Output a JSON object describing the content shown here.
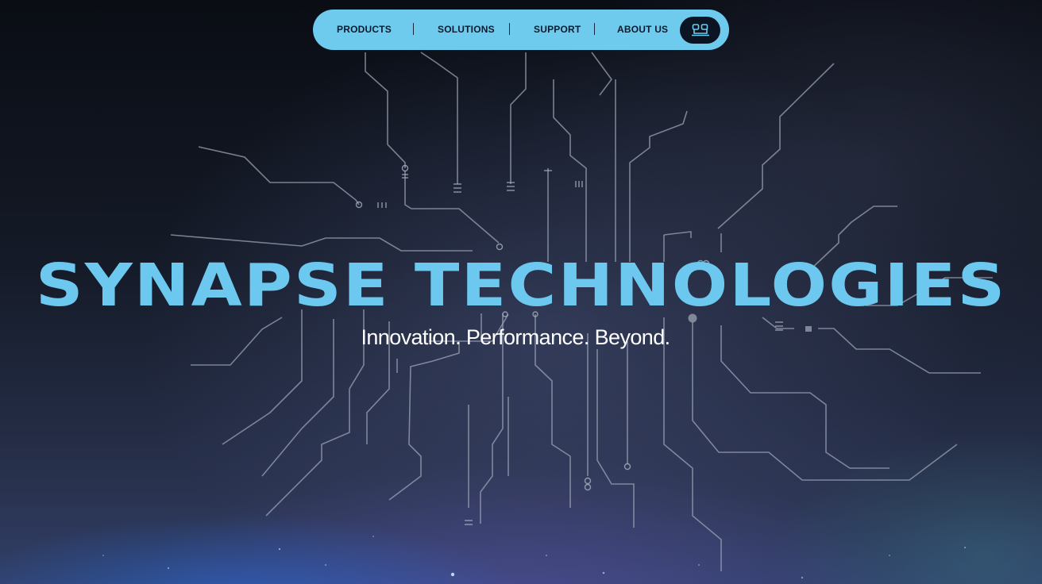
{
  "nav": {
    "items": [
      {
        "label": "PRODUCTS"
      },
      {
        "label": "SOLUTIONS"
      },
      {
        "label": "SUPPORT"
      },
      {
        "label": "ABOUT US"
      }
    ],
    "login_icon": "user-profile-icon"
  },
  "hero": {
    "title_first": "Synapse",
    "title_second": "Technologies",
    "tagline": "Innovation. Performance. Beyond."
  },
  "colors": {
    "nav_background": "#6ecbee",
    "nav_text": "#0d1a2b",
    "title": "#6cc8ee",
    "tagline": "#ffffff",
    "login_button": "#0b1423"
  }
}
